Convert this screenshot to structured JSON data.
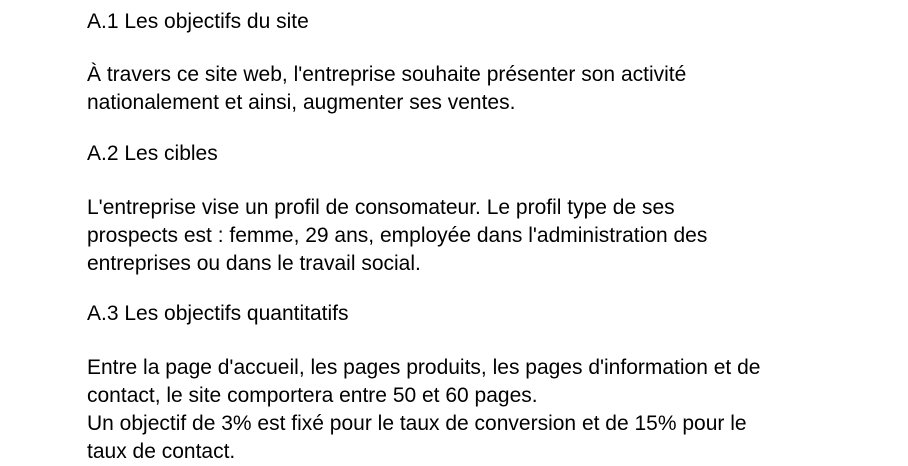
{
  "sections": [
    {
      "heading": "A.1 Les objectifs du site",
      "lines": [
        "À travers ce site web, l'entreprise souhaite présenter son activité",
        "nationalement et ainsi, augmenter ses ventes."
      ]
    },
    {
      "heading": "A.2 Les cibles",
      "lines": [
        "L'entreprise vise un profil de consomateur. Le profil type de ses",
        "prospects est : femme, 29 ans, employée dans l'administration des",
        "entreprises ou dans le travail social."
      ]
    },
    {
      "heading": "A.3 Les objectifs quantitatifs",
      "lines": [
        "Entre la page d'accueil, les pages produits, les pages d'information et de",
        "contact, le site comportera entre 50 et 60 pages.",
        "Un objectif de 3% est fixé pour le taux de conversion et de 15% pour le",
        "taux de contact."
      ]
    }
  ]
}
